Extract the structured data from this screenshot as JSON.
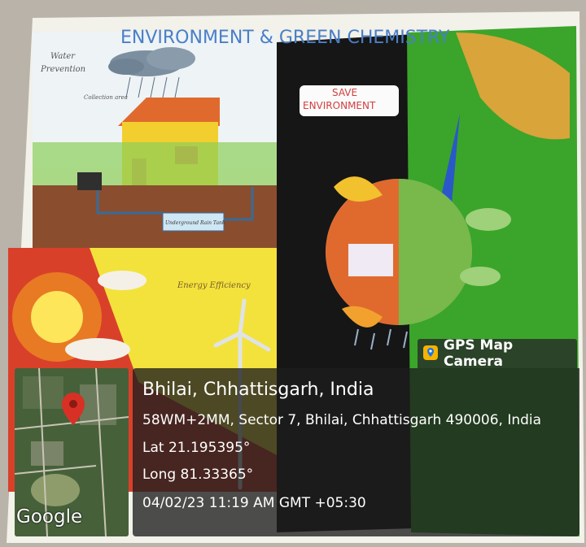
{
  "poster": {
    "title": "ENVIRONMENT & GREEN CHEMISTRY",
    "save_sign": [
      "SAVE",
      "ENVIRONMENT"
    ],
    "water_label": [
      "Water",
      "Prevention"
    ],
    "collection_label": "Collection area",
    "tank_label": "Underground Rain Tank",
    "energy_label": "Energy Efficiency"
  },
  "overlay": {
    "app_badge": "GPS Map Camera",
    "location_title": "Bhilai, Chhattisgarh, India",
    "address": "58WM+2MM, Sector 7, Bhilai, Chhattisgarh 490006, India",
    "lat": "Lat 21.195395°",
    "long": "Long 81.33365°",
    "datetime": "04/02/23 11:19 AM GMT +05:30",
    "map_brand": "Google"
  },
  "colors": {
    "overlay_bg": "#1e1e1e",
    "pin_red": "#d93025",
    "poster_green": "#3aa52a",
    "poster_black": "#151515",
    "sun_red": "#c8281e",
    "sky_blue": "#9ec7e8"
  },
  "icons": {
    "badge_icon": "map-pin-camera-icon",
    "map_pin": "location-pin-icon"
  }
}
